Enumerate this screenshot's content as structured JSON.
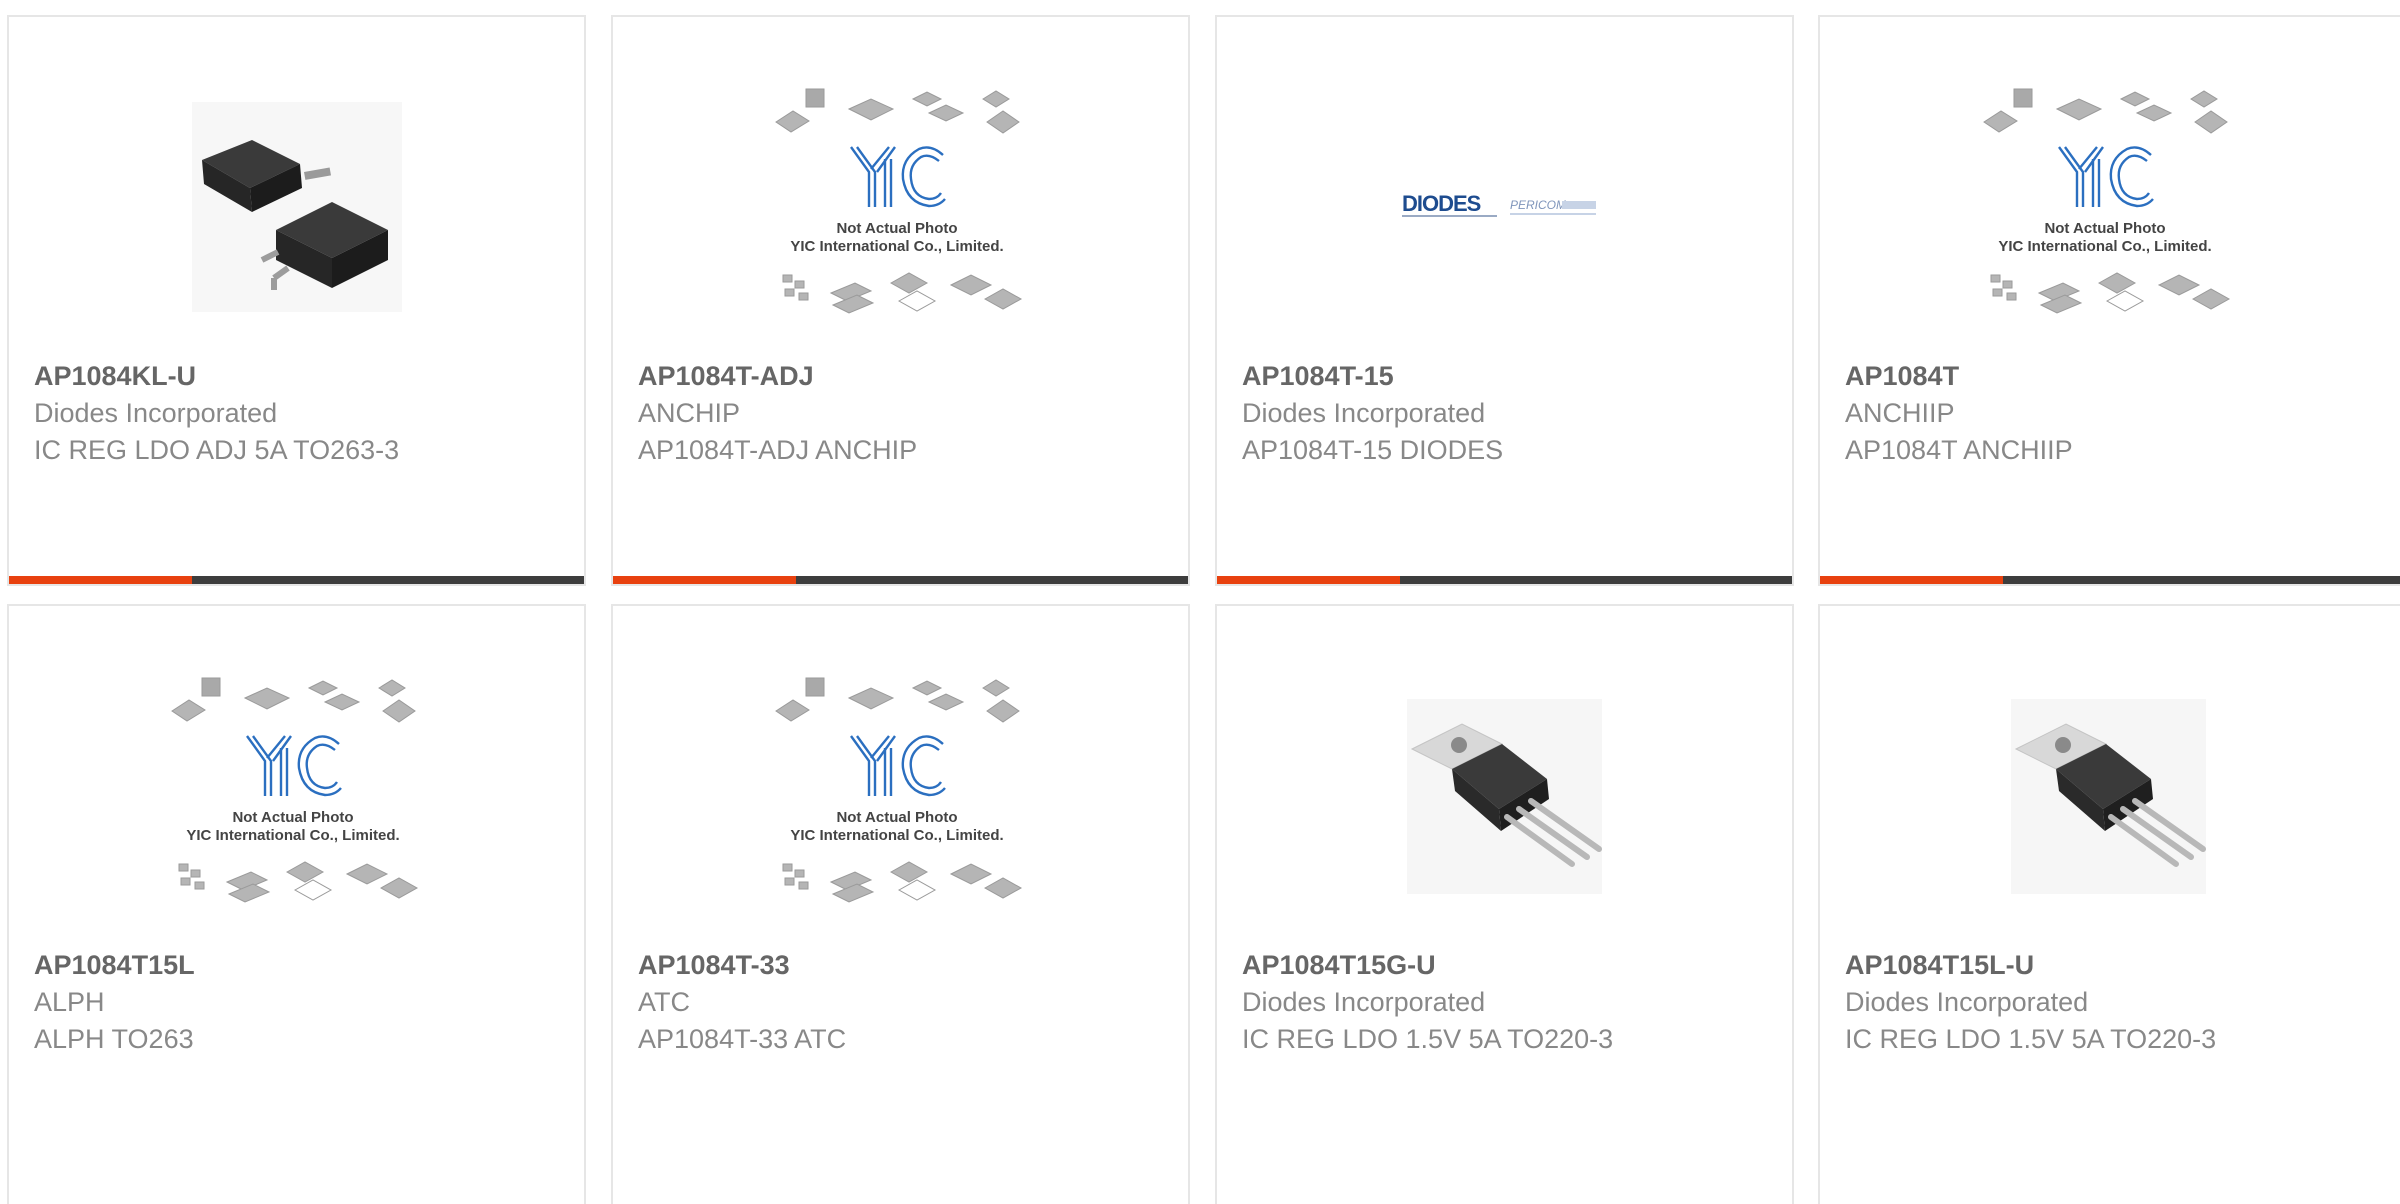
{
  "colors": {
    "accent": "#e8410f",
    "bar": "#3d3d3d",
    "border": "#e6e6e6",
    "part": "#666666",
    "text": "#888888"
  },
  "placeholder": {
    "line1": "Not Actual Photo",
    "line2": "YIC International Co., Limited."
  },
  "logos": {
    "diodes": "DIODES",
    "pericom": "PERICOM"
  },
  "products": [
    {
      "part": "AP1084KL-U",
      "mfr": "Diodes Incorporated",
      "desc": "IC REG LDO ADJ 5A TO263-3",
      "image": "to263-photo"
    },
    {
      "part": "AP1084T-ADJ",
      "mfr": "ANCHIP",
      "desc": "AP1084T-ADJ ANCHIP",
      "image": "yic-placeholder"
    },
    {
      "part": "AP1084T-15",
      "mfr": "Diodes Incorporated",
      "desc": "AP1084T-15 DIODES",
      "image": "diodes-pericom-logo"
    },
    {
      "part": "AP1084T",
      "mfr": "ANCHIIP",
      "desc": "AP1084T ANCHIIP",
      "image": "yic-placeholder"
    },
    {
      "part": "AP1084T15L",
      "mfr": "ALPH",
      "desc": "ALPH TO263",
      "image": "yic-placeholder"
    },
    {
      "part": "AP1084T-33",
      "mfr": "ATC",
      "desc": "AP1084T-33 ATC",
      "image": "yic-placeholder"
    },
    {
      "part": "AP1084T15G-U",
      "mfr": "Diodes Incorporated",
      "desc": "IC REG LDO 1.5V 5A TO220-3",
      "image": "to220-photo"
    },
    {
      "part": "AP1084T15L-U",
      "mfr": "Diodes Incorporated",
      "desc": "IC REG LDO 1.5V 5A TO220-3",
      "image": "to220-photo"
    }
  ]
}
